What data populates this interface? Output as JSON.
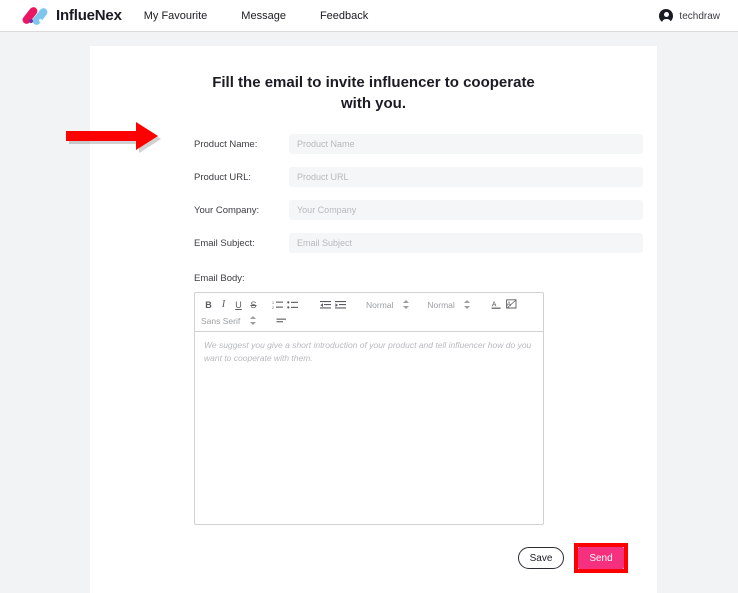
{
  "navbar": {
    "brand_name": "InflueNex",
    "brand_icon": "influenex-logo-icon",
    "links": [
      {
        "label": "My Favourite"
      },
      {
        "label": "Message"
      },
      {
        "label": "Feedback"
      }
    ],
    "user": {
      "name": "techdraw",
      "icon": "user-avatar-icon"
    }
  },
  "main": {
    "title": "Fill the email to invite influencer to cooperate with you.",
    "fields": [
      {
        "label": "Product Name:",
        "value": "",
        "placeholder": "Product Name",
        "name": "product-name"
      },
      {
        "label": "Product URL:",
        "value": "",
        "placeholder": "Product URL",
        "name": "product-url"
      },
      {
        "label": "Your Company:",
        "value": "",
        "placeholder": "Your Company",
        "name": "your-company"
      },
      {
        "label": "Email Subject:",
        "value": "",
        "placeholder": "Email Subject",
        "name": "email-subject"
      }
    ],
    "body_label": "Email Body:",
    "editor": {
      "placeholder": "We suggest you give a short introduction of your product and tell influencer how do you want to cooperate with them.",
      "toolbar": {
        "bold": "B",
        "italic": "I",
        "underline": "U",
        "strike": "S",
        "ordered_list_icon": "ordered-list-icon",
        "bullet_list_icon": "bullet-list-icon",
        "outdent_icon": "outdent-icon",
        "indent_icon": "indent-icon",
        "heading_select": "Normal",
        "size_select": "Normal",
        "text_color_icon": "text-color-icon",
        "highlight_icon": "highlight-color-icon",
        "font_select": "Sans Serif",
        "align_icon": "align-icon"
      }
    },
    "buttons": {
      "save": "Save",
      "send": "Send"
    }
  },
  "annotations": {
    "arrow": {
      "name": "red-pointer-arrow",
      "color": "#ff0000",
      "points_to": "product-name-label"
    },
    "highlight_box": {
      "name": "red-highlight-box",
      "color": "#ff0000",
      "around": "send-button"
    }
  },
  "colors": {
    "page_background": "#f2f3f5",
    "card_background": "#ffffff",
    "accent_pink": "#f5317f",
    "annotation_red": "#ff0000",
    "input_background": "#f5f6f7",
    "text_dark": "#1b1b24",
    "text_muted": "#b7b9bd"
  }
}
